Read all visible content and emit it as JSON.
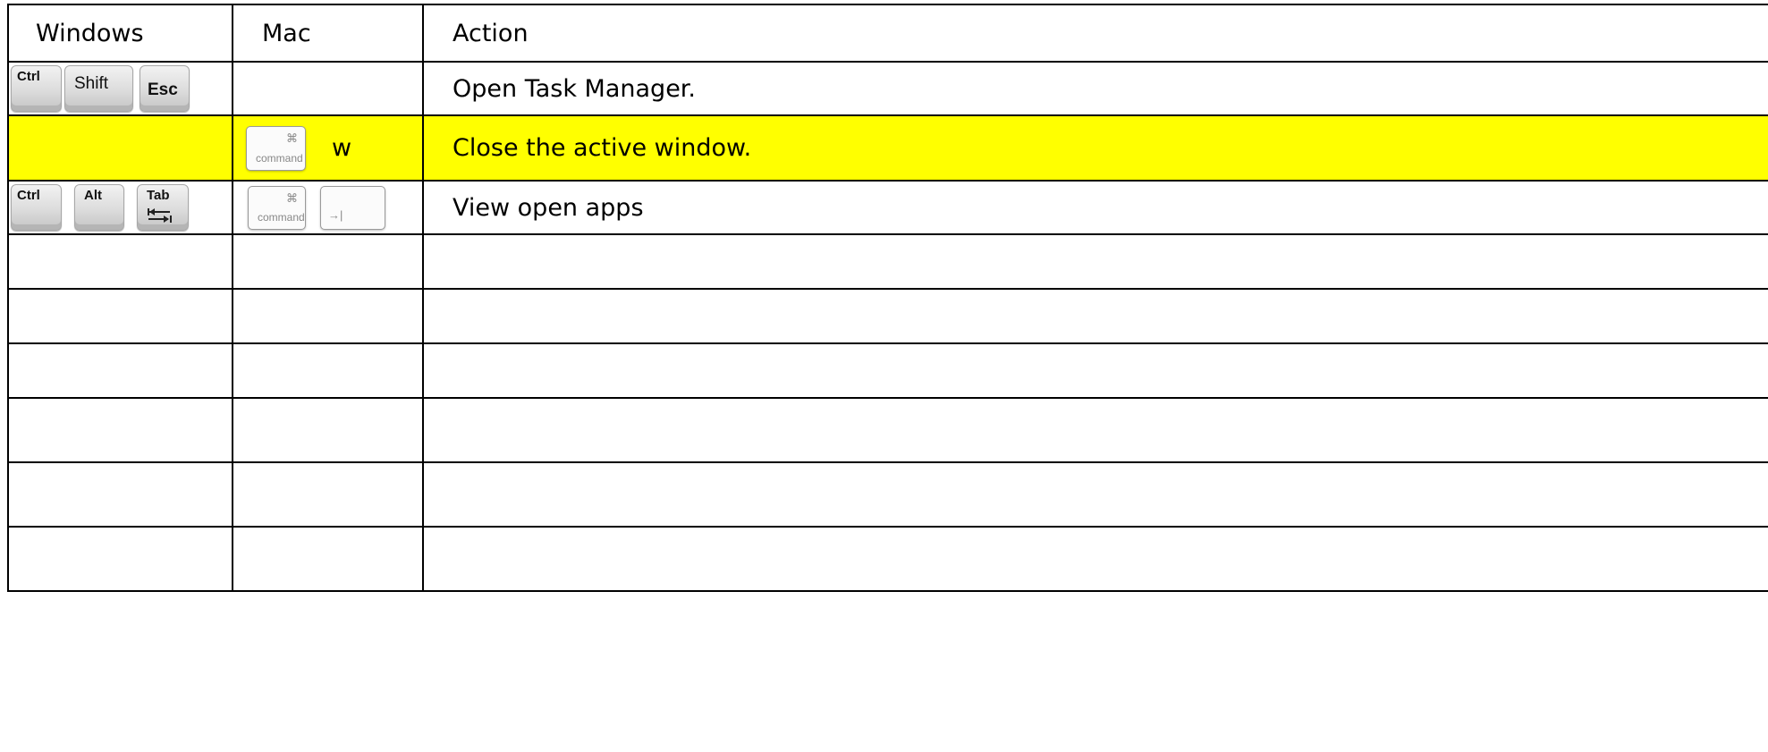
{
  "header": {
    "windows": "Windows",
    "mac": "Mac",
    "action": "Action"
  },
  "rows": [
    {
      "windows_keys": [
        "Ctrl",
        "Shift",
        "Esc"
      ],
      "mac_keys": [],
      "action": "Open Task Manager.",
      "highlight": false
    },
    {
      "windows_keys": [],
      "mac_keys": [
        "⌘ command",
        "w"
      ],
      "mac_key_symbol": "⌘",
      "mac_key_word": "command",
      "mac_letter": "w",
      "action": "Close the active window.",
      "highlight": true
    },
    {
      "windows_keys": [
        "Ctrl",
        "Alt",
        "Tab"
      ],
      "mac_keys": [
        "⌘ command",
        "→|"
      ],
      "mac_key_symbol": "⌘",
      "mac_key_word": "command",
      "mac_tab_symbol": "→|",
      "action": "View open apps",
      "highlight": false
    }
  ],
  "empty_rows": 6,
  "highlight_color": "#ffff00",
  "icons": [
    "tab-arrows-icon",
    "command-icon",
    "tab-icon"
  ]
}
